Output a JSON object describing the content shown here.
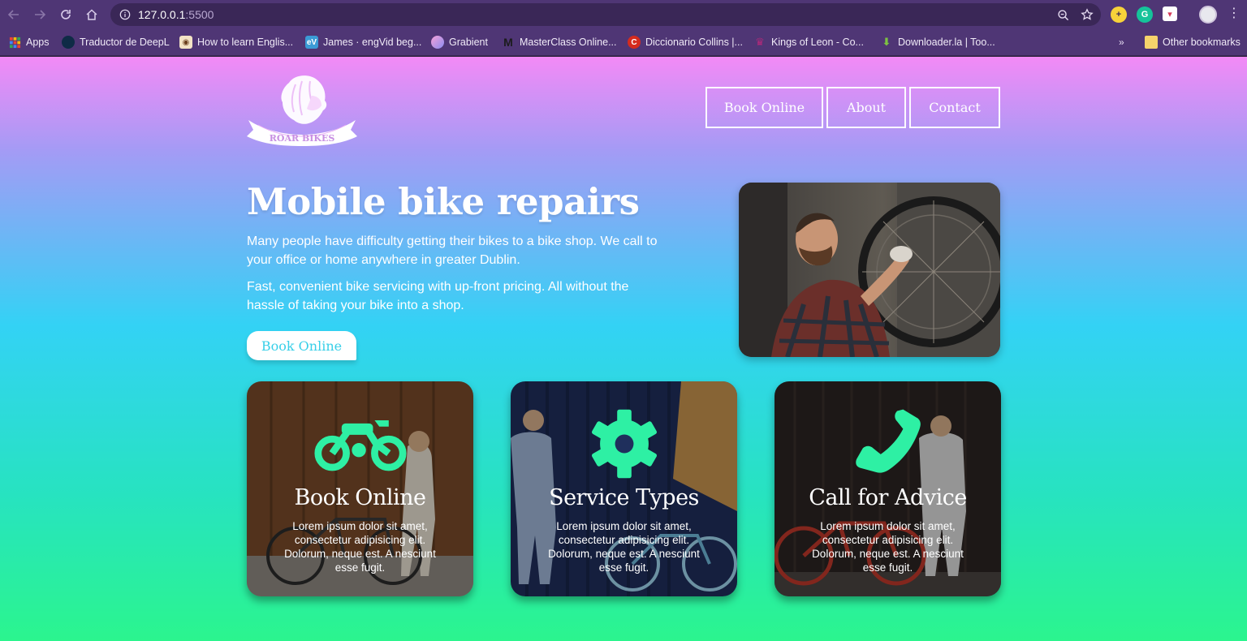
{
  "browser": {
    "url_host": "127.0.0.1",
    "url_port": ":5500",
    "bookmarks": [
      {
        "label": "Apps",
        "icon": "apps-grid-icon"
      },
      {
        "label": "Traductor de DeepL",
        "icon": "deepl-icon"
      },
      {
        "label": "How to learn Englis...",
        "icon": "owl-icon"
      },
      {
        "label": "James · engVid beg...",
        "icon": "engvid-icon"
      },
      {
        "label": "Grabient",
        "icon": "grabient-icon"
      },
      {
        "label": "MasterClass Online...",
        "icon": "masterclass-icon"
      },
      {
        "label": "Diccionario Collins |...",
        "icon": "collins-icon"
      },
      {
        "label": "Kings of Leon - Co...",
        "icon": "crown-icon"
      },
      {
        "label": "Downloader.la | Too...",
        "icon": "downloader-icon"
      }
    ],
    "bookmarks_overflow": "»",
    "other_bookmarks": "Other bookmarks"
  },
  "site": {
    "logo_text": "ROAR BIKES",
    "nav": [
      {
        "label": "Book Online"
      },
      {
        "label": "About"
      },
      {
        "label": "Contact"
      }
    ],
    "hero": {
      "title": "Mobile bike repairs",
      "paragraph1": "Many people have difficulty getting their bikes to a bike shop. We call to your office or home anywhere in greater Dublin.",
      "paragraph2": "Fast, convenient bike servicing with up-front pricing. All without the hassle of taking your bike into a shop.",
      "cta": "Book Online"
    },
    "cards": [
      {
        "title": "Book Online",
        "icon": "motorbike-icon",
        "text": "Lorem ipsum dolor sit amet, consectetur adipisicing elit. Dolorum, neque est. A nesciunt esse fugit."
      },
      {
        "title": "Service Types",
        "icon": "gear-icon",
        "text": "Lorem ipsum dolor sit amet, consectetur adipisicing elit. Dolorum, neque est. A nesciunt esse fugit."
      },
      {
        "title": "Call for Advice",
        "icon": "phone-icon",
        "text": "Lorem ipsum dolor sit amet, consectetur adipisicing elit. Dolorum, neque est. A nesciunt esse fugit."
      }
    ]
  },
  "colors": {
    "chrome": "#4f3675",
    "accent_icon": "#2ef0a4",
    "cta_text": "#37cfe8"
  }
}
